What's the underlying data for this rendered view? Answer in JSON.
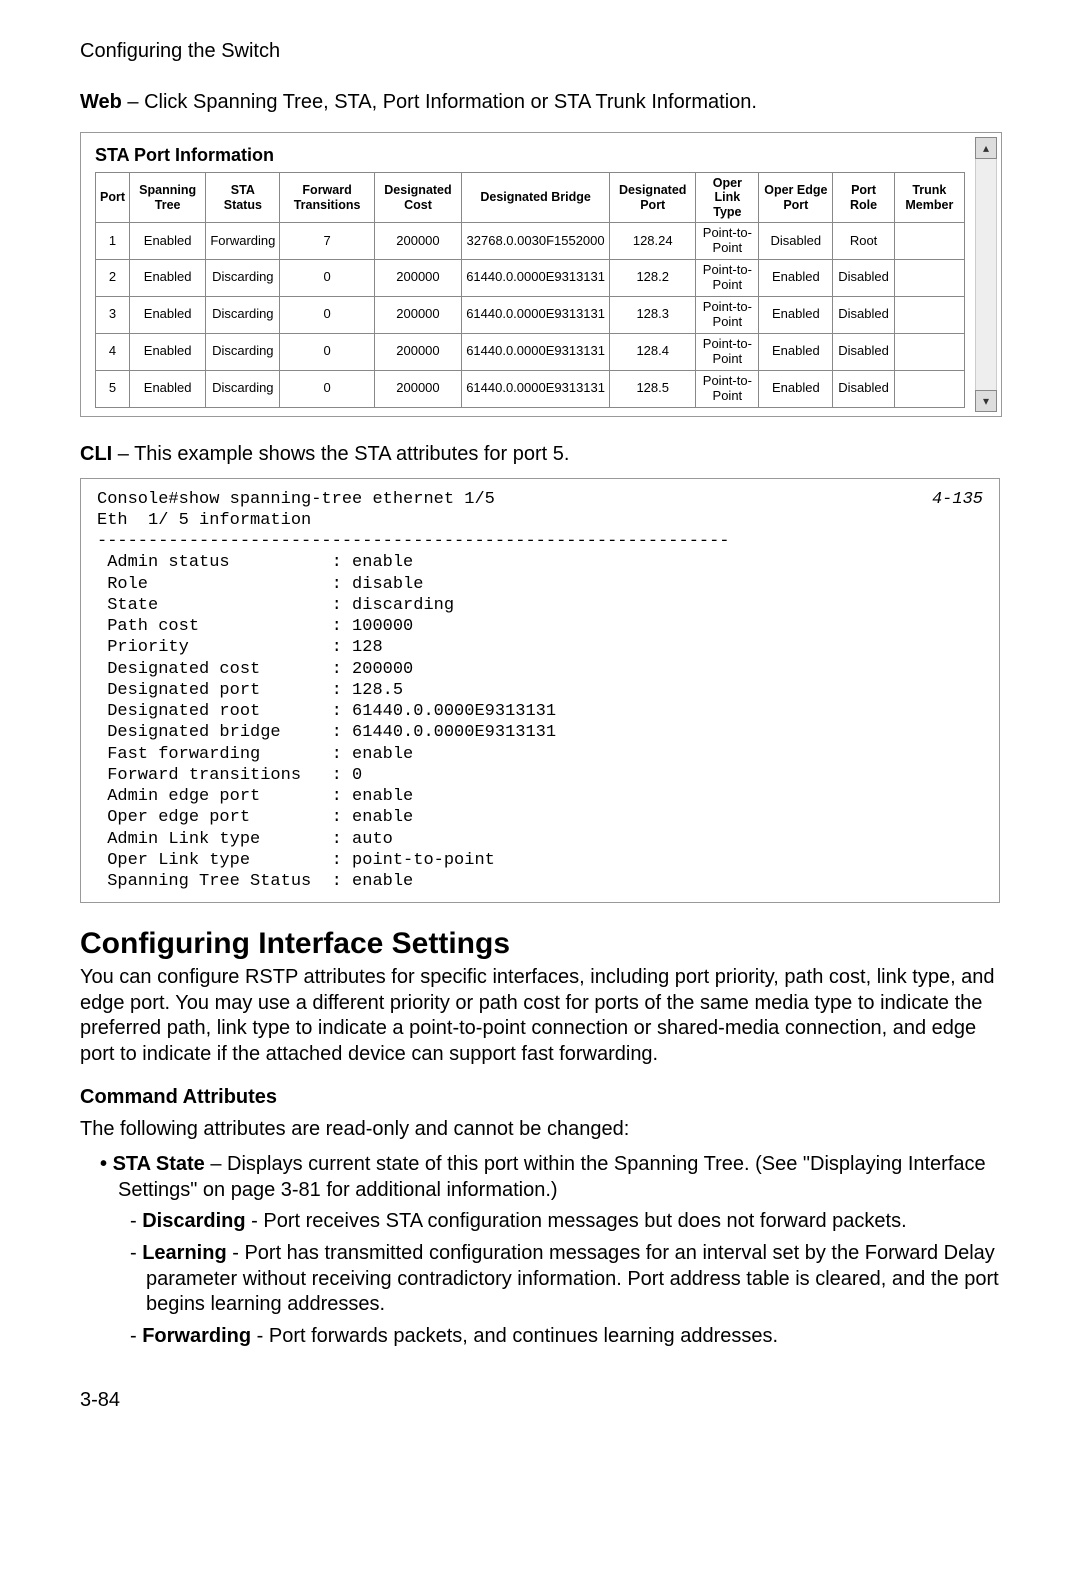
{
  "header": "Configuring the Switch",
  "web_prefix": "Web",
  "web_text": " – Click Spanning Tree, STA, Port Information or STA Trunk Information.",
  "panel_title": "STA Port Information",
  "table": {
    "headers": [
      "Port",
      "Spanning Tree",
      "STA Status",
      "Forward Transitions",
      "Designated Cost",
      "Designated Bridge",
      "Designated Port",
      "Oper Link Type",
      "Oper Edge Port",
      "Port Role",
      "Trunk Member"
    ],
    "rows": [
      [
        "1",
        "Enabled",
        "Forwarding",
        "7",
        "200000",
        "32768.0.0030F1552000",
        "128.24",
        "Point-to-Point",
        "Disabled",
        "Root",
        ""
      ],
      [
        "2",
        "Enabled",
        "Discarding",
        "0",
        "200000",
        "61440.0.0000E9313131",
        "128.2",
        "Point-to-Point",
        "Enabled",
        "Disabled",
        ""
      ],
      [
        "3",
        "Enabled",
        "Discarding",
        "0",
        "200000",
        "61440.0.0000E9313131",
        "128.3",
        "Point-to-Point",
        "Enabled",
        "Disabled",
        ""
      ],
      [
        "4",
        "Enabled",
        "Discarding",
        "0",
        "200000",
        "61440.0.0000E9313131",
        "128.4",
        "Point-to-Point",
        "Enabled",
        "Disabled",
        ""
      ],
      [
        "5",
        "Enabled",
        "Discarding",
        "0",
        "200000",
        "61440.0.0000E9313131",
        "128.5",
        "Point-to-Point",
        "Enabled",
        "Disabled",
        ""
      ]
    ]
  },
  "cli_prefix": "CLI",
  "cli_intro": " – This example shows the STA attributes for port 5.",
  "cli_pageref": "4-135",
  "cli_block": "Console#show spanning-tree ethernet 1/5\nEth  1/ 5 information\n--------------------------------------------------------------\n Admin status          : enable\n Role                  : disable\n State                 : discarding\n Path cost             : 100000\n Priority              : 128\n Designated cost       : 200000\n Designated port       : 128.5\n Designated root       : 61440.0.0000E9313131\n Designated bridge     : 61440.0.0000E9313131\n Fast forwarding       : enable\n Forward transitions   : 0\n Admin edge port       : enable\n Oper edge port        : enable\n Admin Link type       : auto\n Oper Link type        : point-to-point\n Spanning Tree Status  : enable",
  "section_title": "Configuring Interface Settings",
  "section_body": "You can configure RSTP attributes for specific interfaces, including port priority, path cost, link type, and edge port. You may use a different priority or path cost for ports of the same media type to indicate the preferred path, link type to indicate a point-to-point connection or shared-media connection, and edge port to indicate if the attached device can support fast forwarding.",
  "cmd_attr_label": "Command Attributes",
  "readonly_intro": "The following attributes are read-only and cannot be changed:",
  "sta_state": {
    "label": "STA State",
    "text": " – Displays current state of this port within the Spanning Tree. (See \"Displaying Interface Settings\" on page 3-81 for additional information.)",
    "items": [
      {
        "label": "Discarding",
        "text": " - Port receives STA configuration messages but does not forward packets."
      },
      {
        "label": "Learning",
        "text": " - Port has transmitted configuration messages for an interval set by the Forward Delay parameter without receiving contradictory information. Port address table is cleared, and the port begins learning addresses."
      },
      {
        "label": "Forwarding",
        "text": " - Port forwards packets, and continues learning addresses."
      }
    ]
  },
  "page_number": "3-84"
}
